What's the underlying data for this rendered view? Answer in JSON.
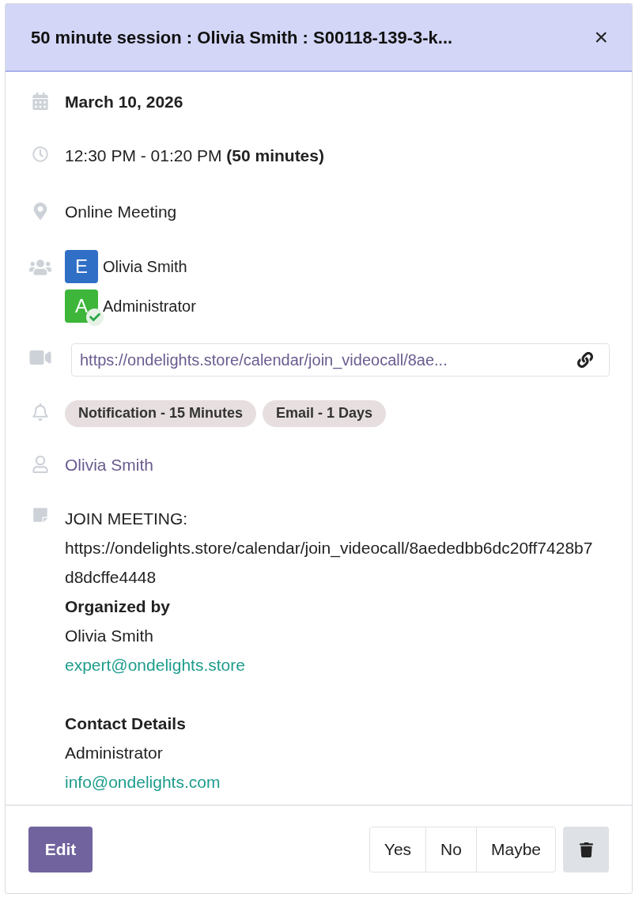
{
  "header": {
    "title": "50 minute session : Olivia Smith : S00118-139-3-k...",
    "close": "×"
  },
  "date": "March 10, 2026",
  "time": {
    "range": "12:30 PM - 01:20 PM",
    "duration": "(50 minutes)"
  },
  "location": "Online Meeting",
  "attendees": [
    {
      "initial": "E",
      "name": "Olivia Smith",
      "color": "#2f6fc5",
      "accepted": false
    },
    {
      "initial": "A",
      "name": "Administrator",
      "color": "#3db63a",
      "accepted": true
    }
  ],
  "video_link": "https://ondelights.store/calendar/join_videocall/8ae...",
  "reminders": [
    "Notification - 15 Minutes",
    "Email - 1 Days"
  ],
  "organizer": "Olivia Smith",
  "description": [
    {
      "kind": "text",
      "text": "JOIN MEETING:"
    },
    {
      "kind": "text",
      "text": "https://ondelights.store/calendar/join_videocall/8aededbb6dc20ff7428b7d8dcffe4448"
    },
    {
      "kind": "heading",
      "text": "Organized by"
    },
    {
      "kind": "text",
      "text": "Olivia Smith"
    },
    {
      "kind": "link",
      "text": "expert@ondelights.store"
    },
    {
      "kind": "gap"
    },
    {
      "kind": "heading",
      "text": "Contact Details"
    },
    {
      "kind": "text",
      "text": "Administrator"
    },
    {
      "kind": "link",
      "text": "info@ondelights.com"
    }
  ],
  "footer": {
    "edit": "Edit",
    "responses": [
      "Yes",
      "No",
      "Maybe"
    ]
  }
}
